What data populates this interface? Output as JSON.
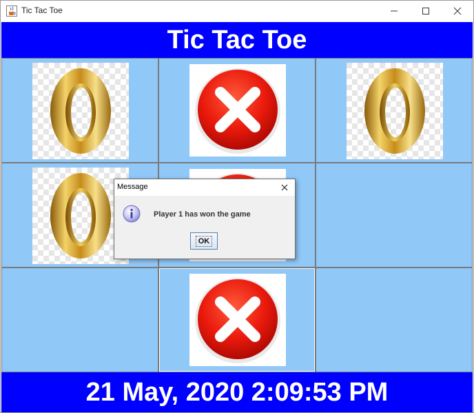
{
  "window": {
    "title": "Tic Tac Toe",
    "app_icon": "java-cup-icon"
  },
  "header": {
    "title": "Tic Tac Toe"
  },
  "board": {
    "cells": [
      {
        "mark": "O"
      },
      {
        "mark": "X"
      },
      {
        "mark": "O"
      },
      {
        "mark": "O"
      },
      {
        "mark": "X"
      },
      {
        "mark": ""
      },
      {
        "mark": ""
      },
      {
        "mark": "X"
      },
      {
        "mark": ""
      }
    ]
  },
  "footer": {
    "datetime": "21 May, 2020 2:09:53 PM"
  },
  "dialog": {
    "title": "Message",
    "icon": "info-icon",
    "message": "Player 1 has won the game",
    "ok_label": "OK"
  },
  "colors": {
    "banner": "#0000ff",
    "cell": "#90c8f8",
    "x_red": "#e8150c",
    "o_gold": "#d8a520"
  }
}
